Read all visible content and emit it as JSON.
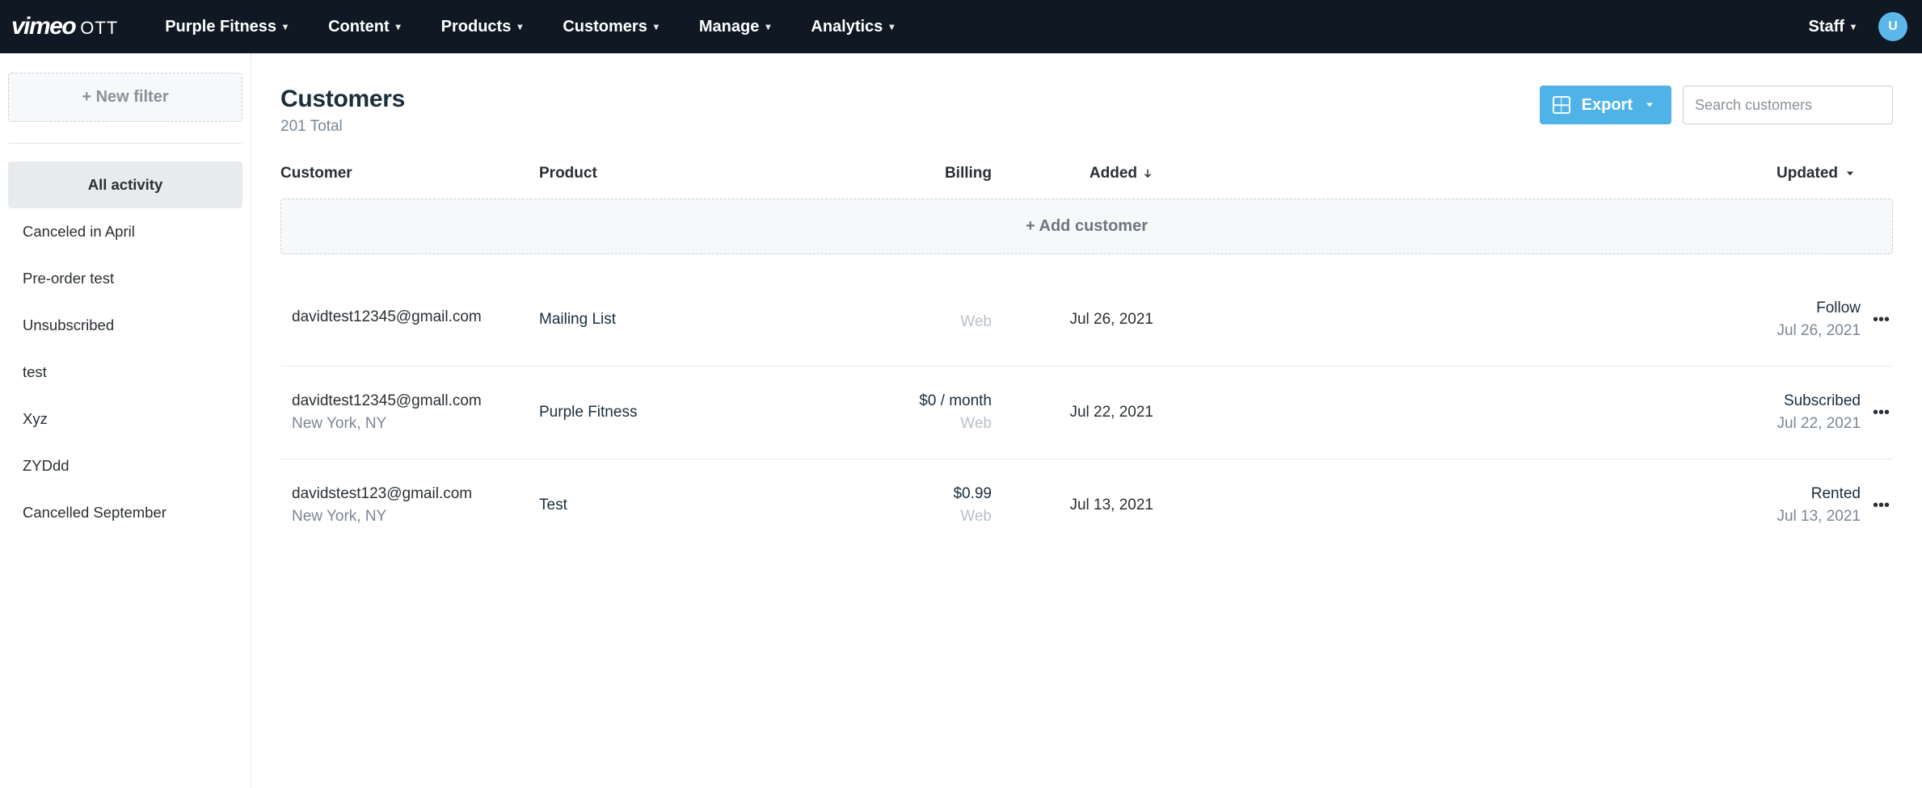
{
  "header": {
    "logo_primary": "vimeo",
    "logo_secondary": "OTT",
    "site_name": "Purple Fitness",
    "nav": {
      "content": "Content",
      "products": "Products",
      "customers": "Customers",
      "manage": "Manage",
      "analytics": "Analytics"
    },
    "staff_label": "Staff",
    "avatar_letter": "U"
  },
  "sidebar": {
    "new_filter": "+ New filter",
    "filters": [
      "All activity",
      "Canceled in April",
      "Pre-order test",
      "Unsubscribed",
      "test",
      "Xyz",
      "ZYDdd",
      "Cancelled September"
    ]
  },
  "main": {
    "title": "Customers",
    "subtitle": "201 Total",
    "export_label": "Export",
    "search_placeholder": "Search customers",
    "cols": {
      "customer": "Customer",
      "product": "Product",
      "billing": "Billing",
      "added": "Added",
      "updated": "Updated"
    },
    "add_customer": "+ Add customer",
    "rows": [
      {
        "email": "davidtest12345@gmail.com",
        "location": "",
        "product": "Mailing List",
        "price": "",
        "source": "Web",
        "added": "Jul 26, 2021",
        "status": "Follow",
        "updated": "Jul 26, 2021"
      },
      {
        "email": "davidtest12345@gmall.com",
        "location": "New York, NY",
        "product": "Purple Fitness",
        "price": "$0 / month",
        "source": "Web",
        "added": "Jul 22, 2021",
        "status": "Subscribed",
        "updated": "Jul 22, 2021"
      },
      {
        "email": "davidstest123@gmail.com",
        "location": "New York, NY",
        "product": "Test",
        "price": "$0.99",
        "source": "Web",
        "added": "Jul 13, 2021",
        "status": "Rented",
        "updated": "Jul 13, 2021"
      }
    ]
  }
}
